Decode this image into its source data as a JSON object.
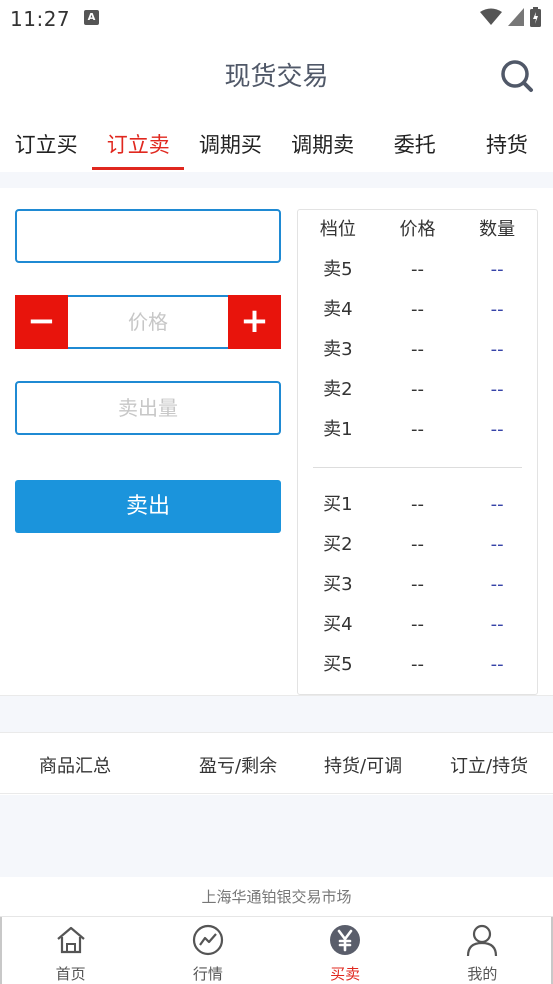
{
  "status_bar": {
    "time": "11:27",
    "notif_icon": "A"
  },
  "header": {
    "title": "现货交易",
    "search_icon": "search-icon"
  },
  "tabs": [
    {
      "label": "订立买",
      "active": false
    },
    {
      "label": "订立卖",
      "active": true
    },
    {
      "label": "调期买",
      "active": false
    },
    {
      "label": "调期卖",
      "active": false
    },
    {
      "label": "委托",
      "active": false
    },
    {
      "label": "持货",
      "active": false
    }
  ],
  "form": {
    "code_value": "",
    "minus": "−",
    "plus": "+",
    "price_placeholder": "价格",
    "qty_placeholder": "卖出量",
    "submit_label": "卖出"
  },
  "order_book": {
    "headers": [
      "档位",
      "价格",
      "数量"
    ],
    "asks": [
      {
        "level": "卖5",
        "price": "--",
        "qty": "--"
      },
      {
        "level": "卖4",
        "price": "--",
        "qty": "--"
      },
      {
        "level": "卖3",
        "price": "--",
        "qty": "--"
      },
      {
        "level": "卖2",
        "price": "--",
        "qty": "--"
      },
      {
        "level": "卖1",
        "price": "--",
        "qty": "--"
      }
    ],
    "bids": [
      {
        "level": "买1",
        "price": "--",
        "qty": "--"
      },
      {
        "level": "买2",
        "price": "--",
        "qty": "--"
      },
      {
        "level": "买3",
        "price": "--",
        "qty": "--"
      },
      {
        "level": "买4",
        "price": "--",
        "qty": "--"
      },
      {
        "level": "买5",
        "price": "--",
        "qty": "--"
      }
    ]
  },
  "summary": {
    "col1": "商品汇总",
    "col2": "盈亏/剩余",
    "col3": "持货/可调",
    "col4": "订立/持货"
  },
  "footer_note": "上海华通铂银交易市场",
  "bottom_nav": [
    {
      "label": "首页",
      "icon": "home-icon",
      "active": false
    },
    {
      "label": "行情",
      "icon": "chart-icon",
      "active": false
    },
    {
      "label": "买卖",
      "icon": "yen-icon",
      "active": true
    },
    {
      "label": "我的",
      "icon": "user-icon",
      "active": false
    }
  ],
  "colors": {
    "accent_red": "#e0281f",
    "primary_blue": "#1b94dc",
    "input_border": "#1f8ad3"
  }
}
